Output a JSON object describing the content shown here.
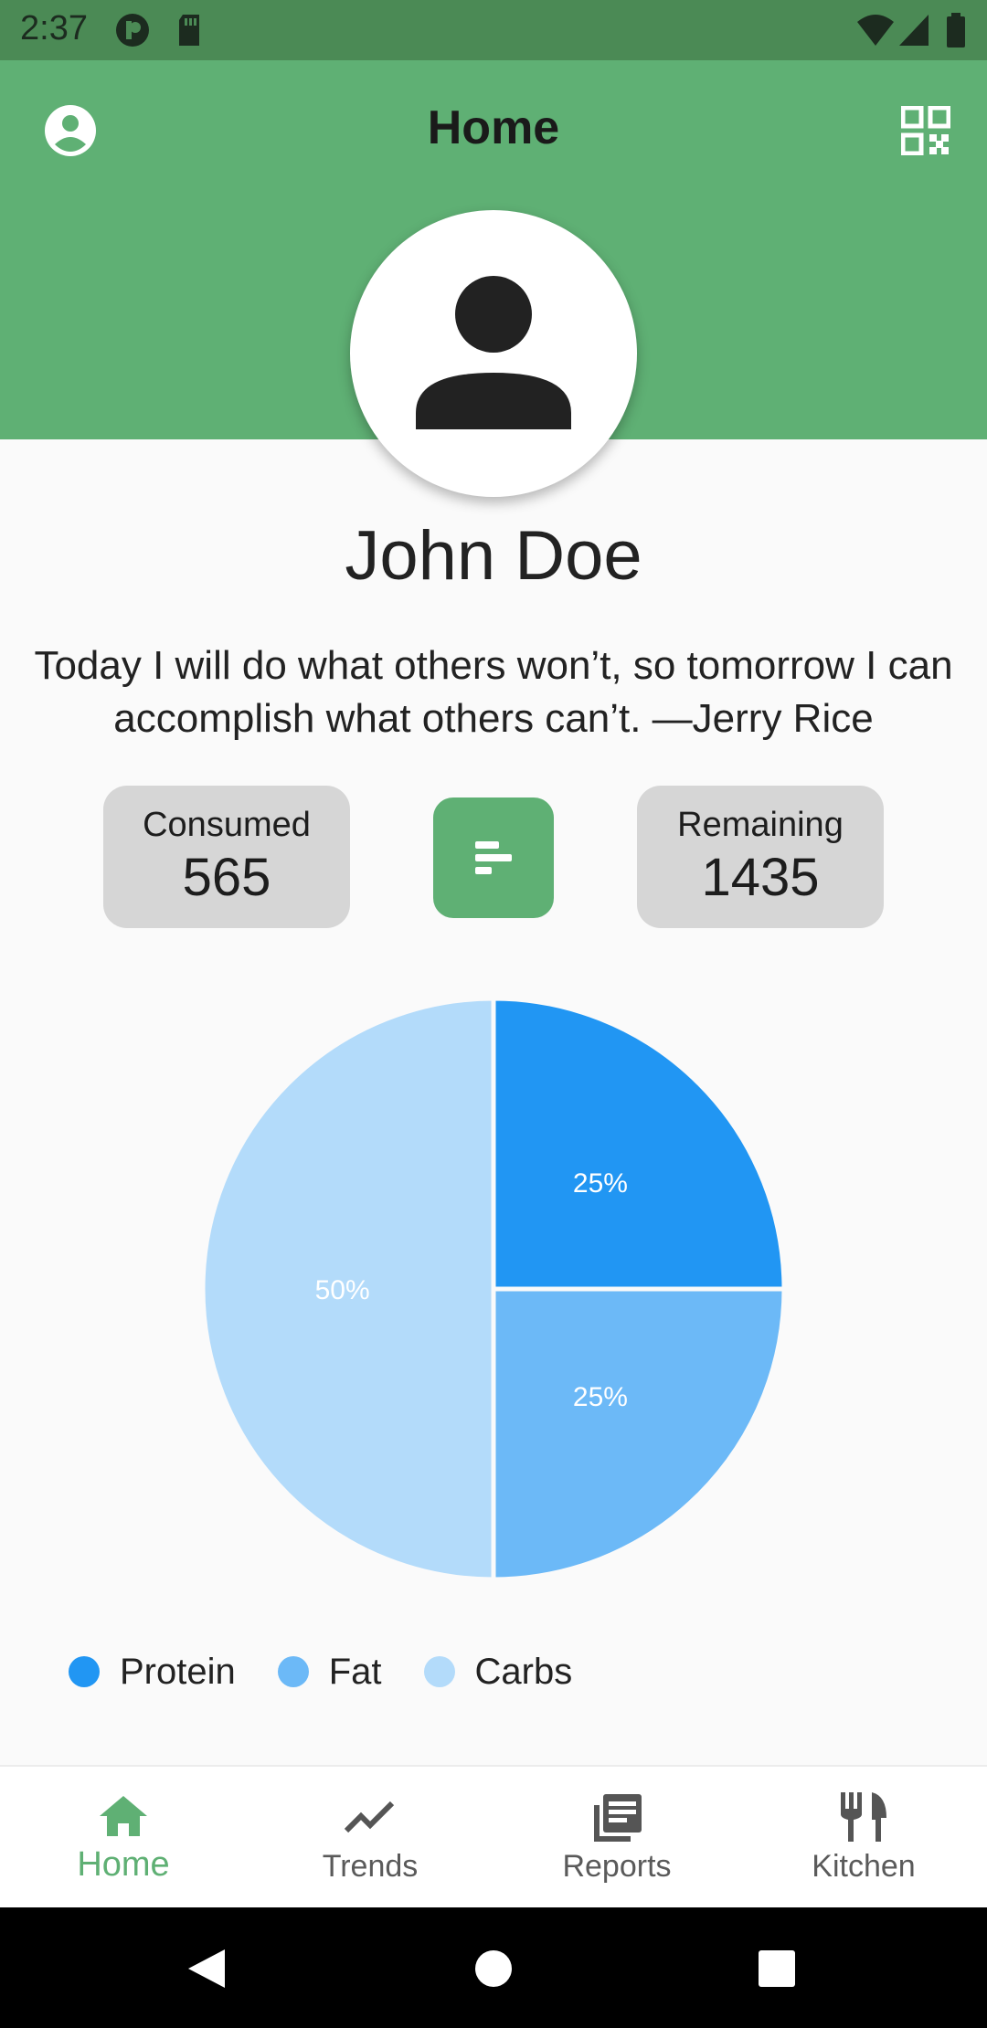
{
  "status_bar": {
    "time": "2:37"
  },
  "app_bar": {
    "title": "Home",
    "left_icon": "account-circle-icon",
    "right_icon": "qr-code-icon",
    "color": "#5fb074"
  },
  "profile": {
    "avatar_icon": "person-icon",
    "name": "John Doe",
    "quote": "Today I will do what others won’t, so tomorrow I can accomplish what others can’t. —Jerry Rice"
  },
  "stats": {
    "consumed": {
      "label": "Consumed",
      "value": "565"
    },
    "remaining": {
      "label": "Remaining",
      "value": "1435"
    },
    "center_button_icon": "sort-icon"
  },
  "chart_data": {
    "type": "pie",
    "slices": [
      {
        "name": "Protein",
        "value": 25,
        "label": "25%",
        "color": "#2196f3"
      },
      {
        "name": "Fat",
        "value": 25,
        "label": "25%",
        "color": "#6cb9f7"
      },
      {
        "name": "Carbs",
        "value": 50,
        "label": "50%",
        "color": "#b3dbfa"
      }
    ],
    "legend": [
      "Protein",
      "Fat",
      "Carbs"
    ],
    "legend_position": "bottom-left"
  },
  "bottom_nav": {
    "active_color": "#5fb074",
    "items": [
      {
        "label": "Home",
        "icon": "home-icon",
        "active": true
      },
      {
        "label": "Trends",
        "icon": "trending-icon",
        "active": false
      },
      {
        "label": "Reports",
        "icon": "reports-icon",
        "active": false
      },
      {
        "label": "Kitchen",
        "icon": "cutlery-icon",
        "active": false
      }
    ]
  }
}
